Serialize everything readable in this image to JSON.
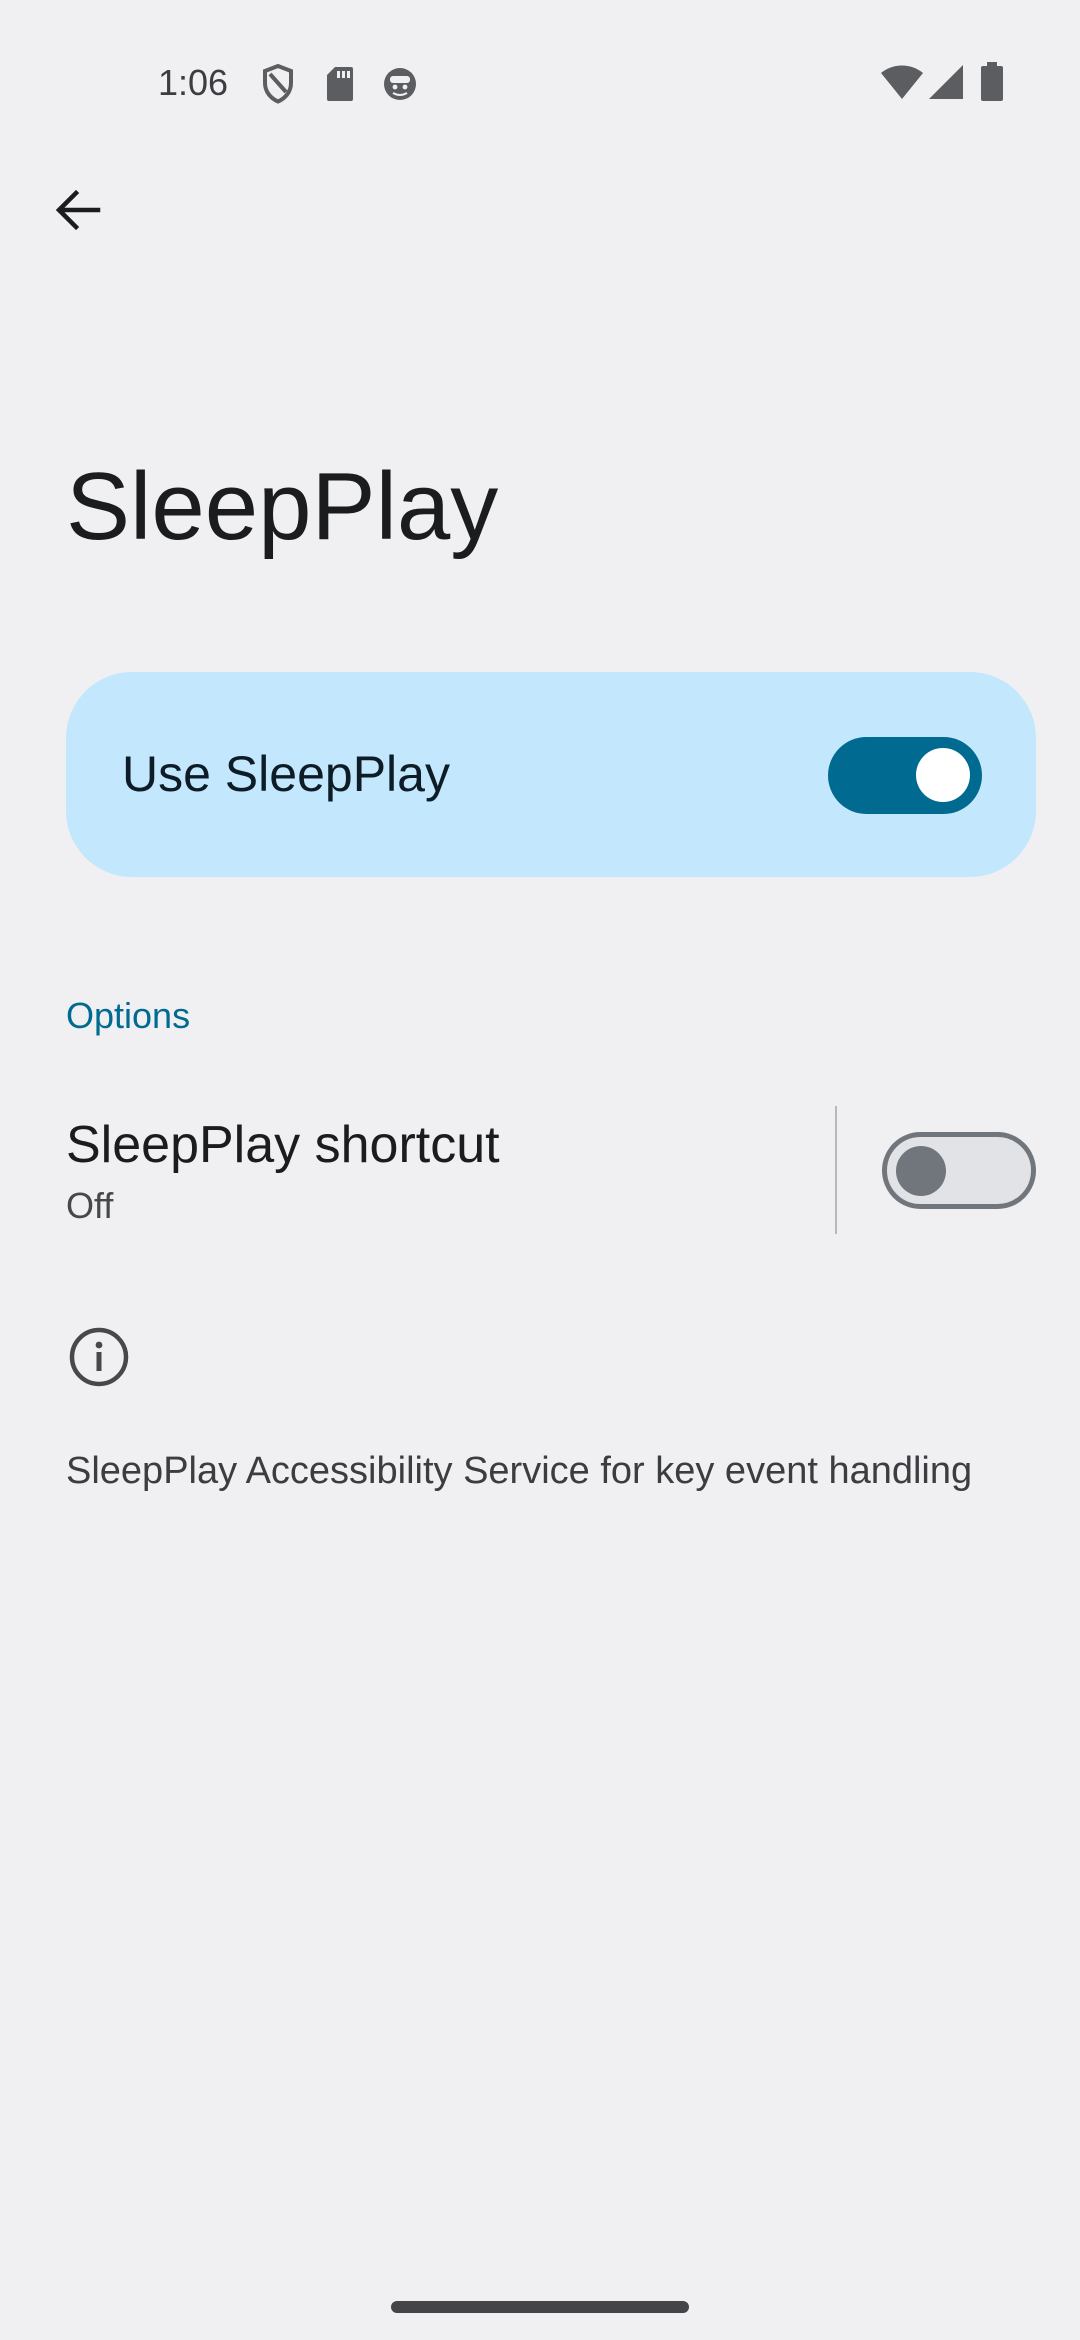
{
  "status_bar": {
    "time": "1:06",
    "left_icons": [
      "shield-icon",
      "sd-card-icon",
      "android-face-icon"
    ],
    "right_icons": [
      "wifi-icon",
      "cell-signal-icon",
      "battery-icon"
    ]
  },
  "toolbar": {
    "back_icon": "arrow-back-icon"
  },
  "page": {
    "title": "SleepPlay"
  },
  "main_switch": {
    "label": "Use SleepPlay",
    "checked": true,
    "accent_color": "#006a90",
    "card_color": "#c3e7fc"
  },
  "options": {
    "header": "Options",
    "shortcut": {
      "title": "SleepPlay shortcut",
      "summary": "Off",
      "checked": false
    }
  },
  "footer": {
    "info_icon": "info-icon",
    "text": "SleepPlay Accessibility Service for key event handling"
  }
}
